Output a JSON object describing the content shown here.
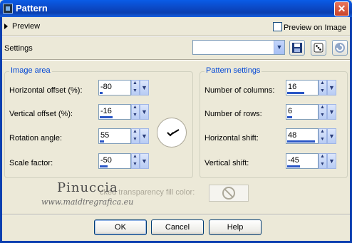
{
  "window": {
    "title": "Pattern",
    "close_glyph": "✕"
  },
  "preview": {
    "label": "Preview",
    "preview_on_image_label": "Preview on Image",
    "preview_on_image_checked": false
  },
  "settings": {
    "label": "Settings",
    "preset_value": ""
  },
  "image_area": {
    "title": "Image area",
    "fields": [
      {
        "label": "Horizontal offset (%):",
        "value": "-80",
        "fill": 0.1
      },
      {
        "label": "Vertical offset (%):",
        "value": "-16",
        "fill": 0.42
      },
      {
        "label": "Rotation angle:",
        "value": "55",
        "fill": 0.14
      },
      {
        "label": "Scale factor:",
        "value": "-50",
        "fill": 0.25
      }
    ]
  },
  "pattern_settings": {
    "title": "Pattern settings",
    "fields": [
      {
        "label": "Number of columns:",
        "value": "16",
        "fill": 0.55
      },
      {
        "label": "Number of rows:",
        "value": "6",
        "fill": 0.16
      },
      {
        "label": "Horizontal shift:",
        "value": "48",
        "fill": 0.88
      },
      {
        "label": "Vertical shift:",
        "value": "-45",
        "fill": 0.4
      }
    ]
  },
  "transparency": {
    "label_visible": "cked transparency fill color:"
  },
  "watermark": {
    "name": "Pinuccia",
    "url": "www.maidiregrafica.eu"
  },
  "buttons": {
    "ok": "OK",
    "cancel": "Cancel",
    "help": "Help"
  },
  "colors": {
    "accent": "#0046d5",
    "titlebar": "#0a3fb0",
    "slider": "#2a56c6"
  }
}
